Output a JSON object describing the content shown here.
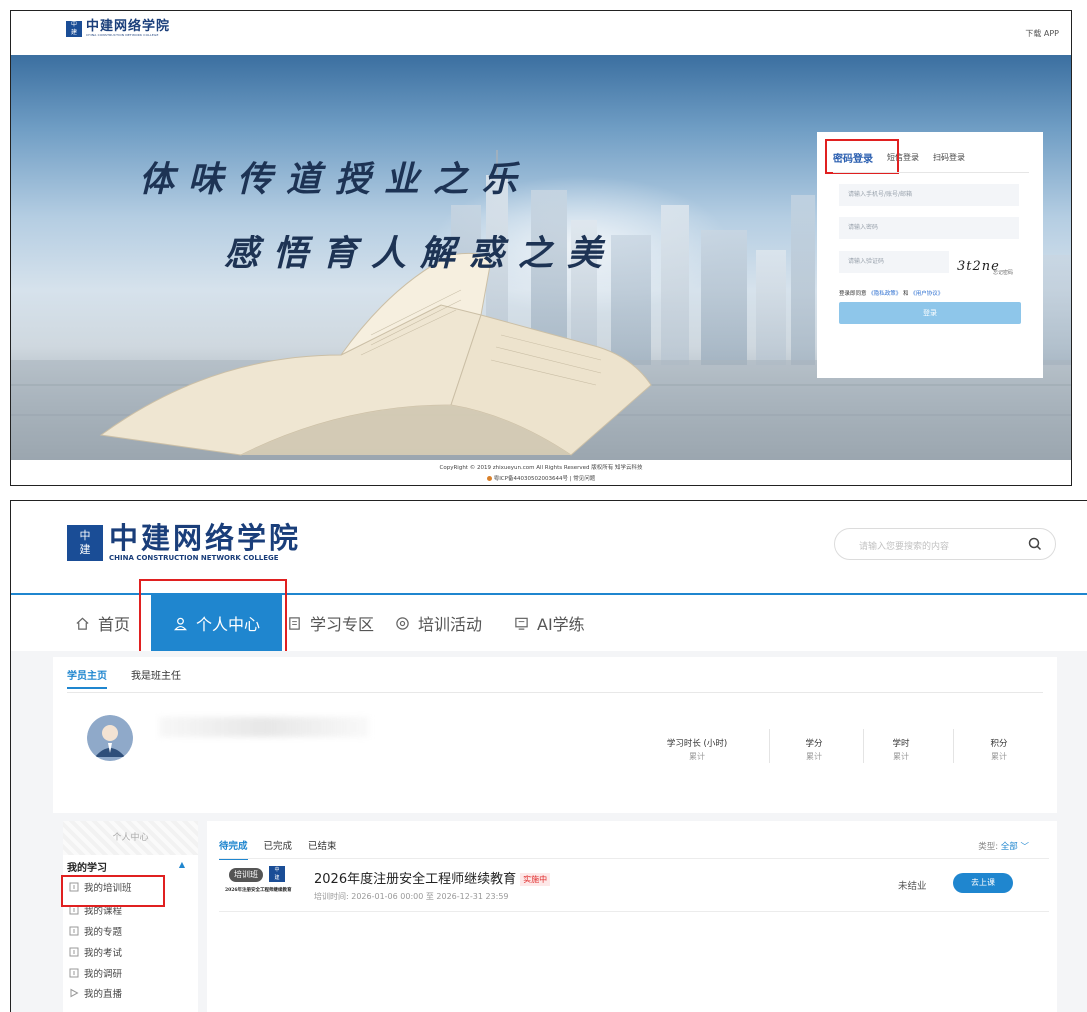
{
  "login_page": {
    "brand_cn": "中建网络学院",
    "brand_en": "CHINA CONSTRUCTION NETWORK COLLEGE",
    "download_app": "下载 APP",
    "slogan_line1": "体味传道授业之乐",
    "slogan_line2": "感悟育人解惑之美",
    "tabs": [
      "密码登录",
      "短信登录",
      "扫码登录"
    ],
    "active_tab": "密码登录",
    "account_placeholder": "请输入手机号/账号/邮箱",
    "password_placeholder": "请输入密码",
    "captcha_placeholder": "请输入验证码",
    "captcha_code": "3t2ne",
    "captcha_refresh": "忘记密码",
    "agree_prefix": "登录即同意",
    "privacy_link": "《隐私政策》",
    "and_text": "和",
    "terms_link": "《用户协议》",
    "login_button": "登录",
    "copyright": "CopyRight © 2019 zhixueyun.com All Rights Reserved 版权所有 知学云科技",
    "icp": "粤ICP备44030502003644号 | 常见问题",
    "highlight_color": "#e02020",
    "accent_color": "#2b5fb0"
  },
  "center_page": {
    "brand_cn": "中建网络学院",
    "brand_en": "CHINA CONSTRUCTION NETWORK COLLEGE",
    "search_placeholder": "请输入您要搜索的内容",
    "nav": [
      {
        "label": "首页",
        "icon": "home-icon"
      },
      {
        "label": "个人中心",
        "icon": "user-icon"
      },
      {
        "label": "学习专区",
        "icon": "document-icon"
      },
      {
        "label": "培训活动",
        "icon": "activity-icon"
      },
      {
        "label": "AI学练",
        "icon": "ai-icon"
      }
    ],
    "active_nav": "个人中心",
    "profile_tabs": [
      "学员主页",
      "我是班主任"
    ],
    "stats": [
      {
        "label": "学习时长 (小时)",
        "sub": "累计"
      },
      {
        "label": "学分",
        "sub": "累计"
      },
      {
        "label": "学时",
        "sub": "累计"
      },
      {
        "label": "积分",
        "sub": "累计"
      }
    ],
    "sidebar": {
      "header": "个人中心",
      "section": "我的学习",
      "items": [
        "我的培训班",
        "我的课程",
        "我的专题",
        "我的考试",
        "我的调研",
        "我的直播"
      ]
    },
    "content_tabs": [
      "待完成",
      "已完成",
      "已结束"
    ],
    "filter_label": "类型:",
    "filter_value": "全部",
    "course": {
      "badge": "培训班",
      "caption": "2026年注册安全工程师继续教育",
      "title": "2026年度注册安全工程师继续教育",
      "status": "实施中",
      "time": "培训时间: 2026-01-06 00:00  至  2026-12-31 23:59",
      "state": "未结业",
      "action": "去上课"
    },
    "accent_color": "#1f86cf"
  }
}
